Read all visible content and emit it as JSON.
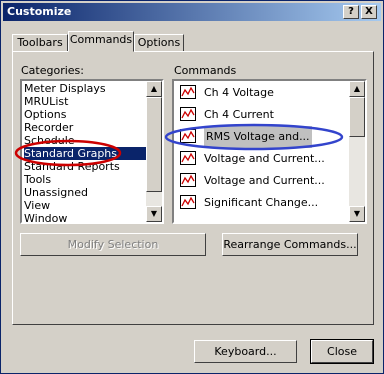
{
  "window": {
    "title": "Customize",
    "close_glyph": "X",
    "help_glyph": "?"
  },
  "tabs": [
    {
      "label": "Toolbars"
    },
    {
      "label": "Commands",
      "active": true
    },
    {
      "label": "Options"
    }
  ],
  "categories": {
    "label": "Categories:",
    "items": [
      "Meter Displays",
      "MRUList",
      "Options",
      "Recorder",
      "Schedule",
      "Standard Graphs",
      "Standard Reports",
      "Tools",
      "Unassigned",
      "View",
      "Window"
    ],
    "selected": "Standard Graphs"
  },
  "commands": {
    "label": "Commands",
    "items": [
      {
        "label": "Ch 4 Voltage"
      },
      {
        "label": "Ch 4 Current"
      },
      {
        "label": "RMS Voltage and..."
      },
      {
        "label": "Voltage and Current..."
      },
      {
        "label": "Voltage and Current..."
      },
      {
        "label": "Significant Change..."
      }
    ],
    "icon": "graph-icon"
  },
  "buttons": {
    "modify_selection": "Modify Selection",
    "rearrange_commands": "Rearrange Commands...",
    "keyboard": "Keyboard...",
    "close": "Close"
  },
  "colors": {
    "title_bar": "#0a246a",
    "highlight_red": "#cc0000",
    "highlight_blue": "#3344cc"
  }
}
